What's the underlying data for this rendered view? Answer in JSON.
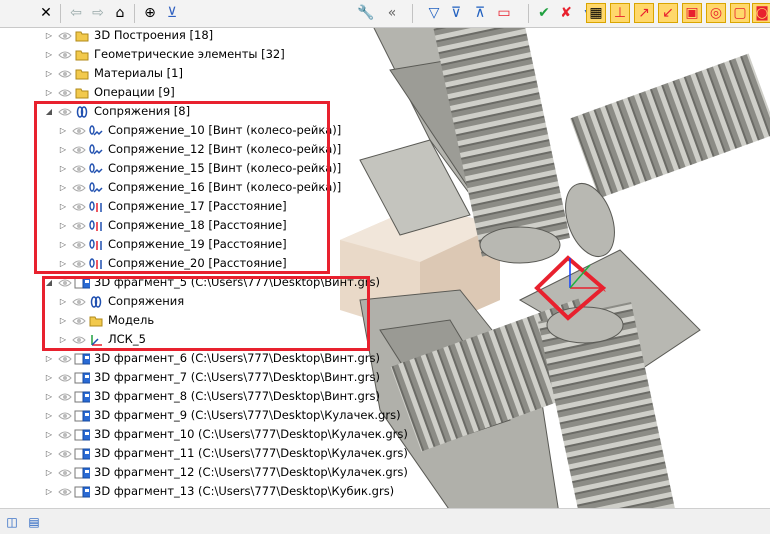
{
  "toolbar": {
    "icons": [
      "close-icon",
      "back-arrow-icon",
      "forward-arrow-icon",
      "home-icon",
      "target-icon",
      "collapse-icon",
      "wrench-icon",
      "double-chevron-left-icon",
      "filter-icon",
      "filter-list-icon",
      "filter-check-icon",
      "select-box-icon",
      "check-icon",
      "uncheck-icon",
      "filter-star-icon",
      "view-grid-icon",
      "axis-1-icon",
      "axis-2-icon",
      "axis-3-icon",
      "cube-icon",
      "cube-outline-icon",
      "cube-solid-icon",
      "cube-red-icon"
    ]
  },
  "tree": {
    "items": [
      {
        "label": "3D Построения [18]",
        "icon": "folder-icon"
      },
      {
        "label": "Геометрические элементы [32]",
        "icon": "folder-icon"
      },
      {
        "label": "Материалы [1]",
        "icon": "folder-icon"
      },
      {
        "label": "Операции [9]",
        "icon": "folder-icon"
      },
      {
        "label": "Сопряжения [8]",
        "icon": "constraint-group-icon"
      },
      {
        "label": "Сопряжение_10 [Винт (колесо-рейка)]",
        "icon": "screw-constraint-icon"
      },
      {
        "label": "Сопряжение_12 [Винт (колесо-рейка)]",
        "icon": "screw-constraint-icon"
      },
      {
        "label": "Сопряжение_15 [Винт (колесо-рейка)]",
        "icon": "screw-constraint-icon"
      },
      {
        "label": "Сопряжение_16 [Винт (колесо-рейка)]",
        "icon": "screw-constraint-icon"
      },
      {
        "label": "Сопряжение_17 [Расстояние]",
        "icon": "distance-constraint-icon"
      },
      {
        "label": "Сопряжение_18 [Расстояние]",
        "icon": "distance-constraint-icon"
      },
      {
        "label": "Сопряжение_19 [Расстояние]",
        "icon": "distance-constraint-icon"
      },
      {
        "label": "Сопряжение_20 [Расстояние]",
        "icon": "distance-constraint-icon"
      },
      {
        "label": "3D фрагмент_5 (C:\\Users\\777\\Desktop\\Винт.grs)",
        "icon": "fragment-icon"
      },
      {
        "label": "Сопряжения",
        "icon": "constraint-group-icon"
      },
      {
        "label": "Модель",
        "icon": "folder-icon"
      },
      {
        "label": "ЛСК_5",
        "icon": "lcs-icon"
      },
      {
        "label": "3D фрагмент_6 (C:\\Users\\777\\Desktop\\Винт.grs)",
        "icon": "fragment-icon"
      },
      {
        "label": "3D фрагмент_7 (C:\\Users\\777\\Desktop\\Винт.grs)",
        "icon": "fragment-icon"
      },
      {
        "label": "3D фрагмент_8 (C:\\Users\\777\\Desktop\\Винт.grs)",
        "icon": "fragment-icon"
      },
      {
        "label": "3D фрагмент_9 (C:\\Users\\777\\Desktop\\Кулачек.grs)",
        "icon": "fragment-icon"
      },
      {
        "label": "3D фрагмент_10 (C:\\Users\\777\\Desktop\\Кулачек.grs)",
        "icon": "fragment-icon"
      },
      {
        "label": "3D фрагмент_11 (C:\\Users\\777\\Desktop\\Кулачек.grs)",
        "icon": "fragment-icon"
      },
      {
        "label": "3D фрагмент_12 (C:\\Users\\777\\Desktop\\Кулачек.grs)",
        "icon": "fragment-icon"
      },
      {
        "label": "3D фрагмент_13 (C:\\Users\\777\\Desktop\\Кубик.grs)",
        "icon": "fragment-icon"
      }
    ]
  },
  "status": {
    "icons": [
      "panel-split-icon",
      "panel-list-icon"
    ]
  },
  "colors": {
    "highlight": "#e8212e",
    "folder": "#f2c94c",
    "toolbar_active": "#ffd86b",
    "part": "#a9a9a4",
    "cube": "#e6d5c4"
  }
}
